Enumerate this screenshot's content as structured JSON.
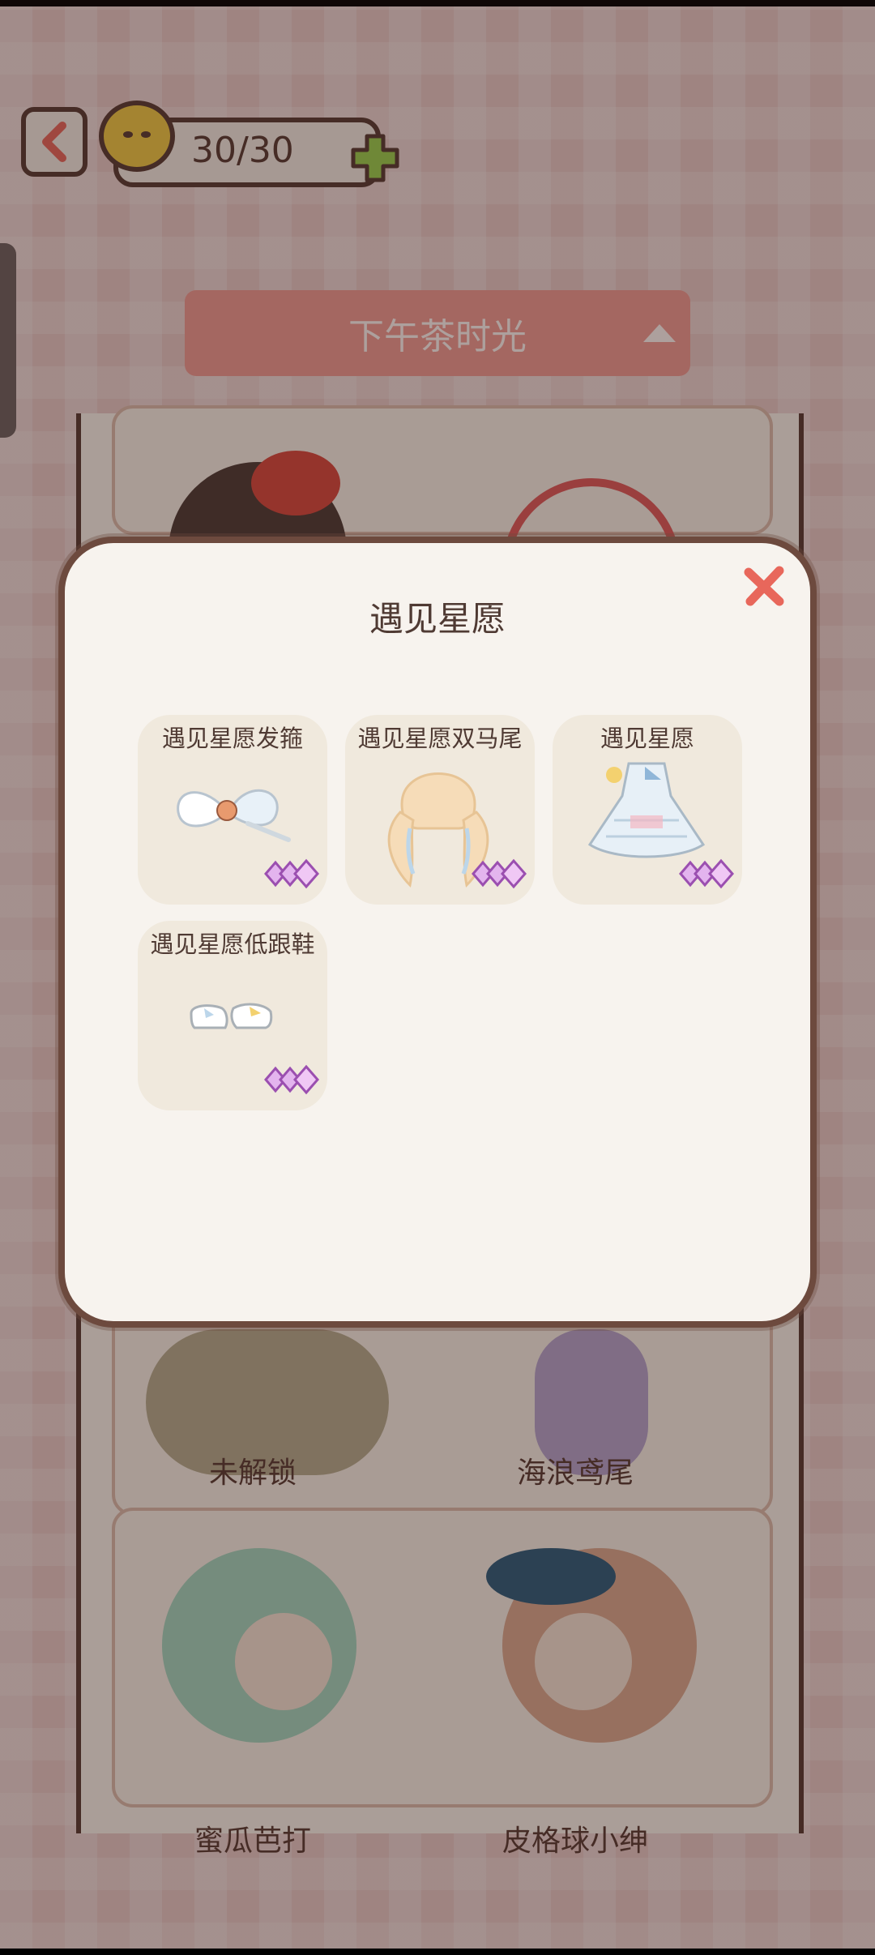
{
  "header": {
    "coins": "30/30"
  },
  "dropdown": {
    "selected": "下午茶时光"
  },
  "background_cards": [
    {
      "label": "未解锁"
    },
    {
      "label": "海浪鸢尾"
    },
    {
      "label": "蜜瓜芭打"
    },
    {
      "label": "皮格球小绅"
    }
  ],
  "modal": {
    "title": "遇见星愿",
    "items": [
      {
        "name": "遇见星愿发箍",
        "icon": "hair-bow-icon"
      },
      {
        "name": "遇见星愿双马尾",
        "icon": "twin-tail-hair-icon"
      },
      {
        "name": "遇见星愿",
        "icon": "dress-icon"
      },
      {
        "name": "遇见星愿低跟鞋",
        "icon": "low-heel-shoes-icon"
      }
    ]
  },
  "colors": {
    "accent": "#f19a92",
    "close": "#e8675b",
    "rarity": "#c98bd6",
    "outline": "#5a3b32"
  }
}
